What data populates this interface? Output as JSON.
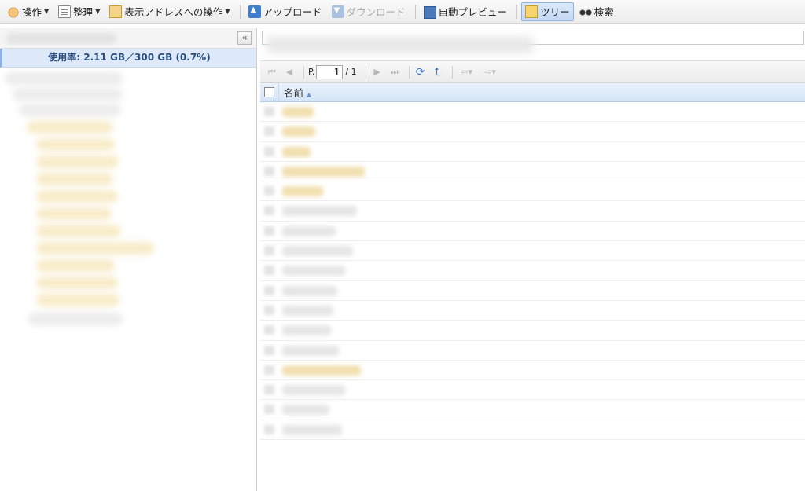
{
  "toolbar": {
    "items": [
      {
        "label": "操作",
        "icon": "hand-icon",
        "dropdown": true
      },
      {
        "label": "整理",
        "icon": "document-icon",
        "dropdown": true
      },
      {
        "label": "表示アドレスへの操作",
        "icon": "address-icon",
        "dropdown": true
      },
      {
        "label": "アップロード",
        "icon": "upload-icon"
      },
      {
        "label": "ダウンロード",
        "icon": "download-icon",
        "disabled": true
      },
      {
        "label": "自動プレビュー",
        "icon": "monitor-icon"
      },
      {
        "label": "ツリー",
        "icon": "tree-icon",
        "active": true
      },
      {
        "label": "検索",
        "icon": "binoculars-icon"
      }
    ]
  },
  "left_panel": {
    "collapse_glyph": "«",
    "usage": "使用率: 2.11 GB／300 GB (0.7%)"
  },
  "pager": {
    "page_label": "P.",
    "page_value": "1",
    "page_total": "/ 1"
  },
  "grid": {
    "name_header": "名前",
    "sort": "ascending"
  },
  "colors": {
    "accent": "#3e78c8",
    "header_bg": "#d4e4f7",
    "usage_text": "#2c4f7f"
  }
}
